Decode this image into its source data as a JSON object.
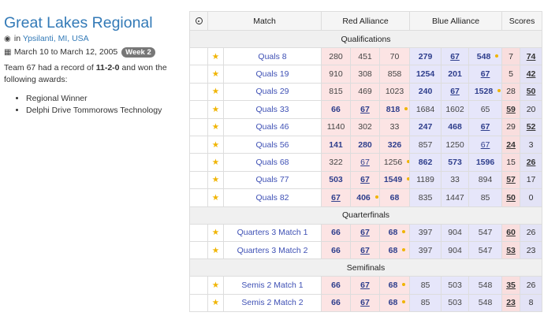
{
  "event": {
    "title": "Great Lakes Regional",
    "location_prefix": "in",
    "location": "Ypsilanti, MI, USA",
    "dates": "March 10 to March 12, 2005",
    "week_badge": "Week 2",
    "record_prefix": "Team 67 had a record of",
    "record": "11-2-0",
    "record_suffix": "and won the following awards:",
    "awards": [
      "Regional Winner",
      "Delphi Drive Tommorows Technology"
    ],
    "icons": {
      "location": "map-marker-icon",
      "dates": "calendar-icon"
    }
  },
  "table": {
    "headers": {
      "match": "Match",
      "red": "Red Alliance",
      "blue": "Blue Alliance",
      "scores": "Scores"
    },
    "colors": {
      "red_bg": "#fce4e4",
      "blue_bg": "#e6e6fa",
      "star": "#f0b400",
      "link": "#3f51b5"
    },
    "sections": [
      {
        "name": "Qualifications",
        "matches": [
          {
            "name": "Quals 8",
            "red": [
              "280",
              "451",
              "70"
            ],
            "blue": [
              "279",
              "67",
              "548"
            ],
            "red_score": "7",
            "blue_score": "74",
            "winner": "blue",
            "dot": [
              5
            ]
          },
          {
            "name": "Quals 19",
            "red": [
              "910",
              "308",
              "858"
            ],
            "blue": [
              "1254",
              "201",
              "67"
            ],
            "red_score": "5",
            "blue_score": "42",
            "winner": "blue",
            "dot": [
              6
            ]
          },
          {
            "name": "Quals 29",
            "red": [
              "815",
              "469",
              "1023"
            ],
            "blue": [
              "240",
              "67",
              "1528"
            ],
            "red_score": "28",
            "blue_score": "50",
            "winner": "blue",
            "dot": [
              5
            ]
          },
          {
            "name": "Quals 33",
            "red": [
              "66",
              "67",
              "818"
            ],
            "blue": [
              "1684",
              "1602",
              "65"
            ],
            "red_score": "59",
            "blue_score": "20",
            "winner": "red",
            "dot": [
              2
            ]
          },
          {
            "name": "Quals 46",
            "red": [
              "1140",
              "302",
              "33"
            ],
            "blue": [
              "247",
              "468",
              "67"
            ],
            "red_score": "29",
            "blue_score": "52",
            "winner": "blue",
            "dot": [
              6
            ]
          },
          {
            "name": "Quals 56",
            "red": [
              "141",
              "280",
              "326"
            ],
            "blue": [
              "857",
              "1250",
              "67"
            ],
            "red_score": "24",
            "blue_score": "3",
            "winner": "red",
            "dot": [
              6
            ]
          },
          {
            "name": "Quals 68",
            "red": [
              "322",
              "67",
              "1256"
            ],
            "blue": [
              "862",
              "573",
              "1596"
            ],
            "red_score": "15",
            "blue_score": "26",
            "winner": "blue",
            "dot": [
              2
            ]
          },
          {
            "name": "Quals 77",
            "red": [
              "503",
              "67",
              "1549"
            ],
            "blue": [
              "1189",
              "33",
              "894"
            ],
            "red_score": "57",
            "blue_score": "17",
            "winner": "red",
            "dot": [
              2
            ]
          },
          {
            "name": "Quals 82",
            "red": [
              "67",
              "406",
              "68"
            ],
            "blue": [
              "835",
              "1447",
              "85"
            ],
            "red_score": "50",
            "blue_score": "0",
            "winner": "red",
            "dot": [
              1
            ]
          }
        ]
      },
      {
        "name": "Quarterfinals",
        "matches": [
          {
            "name": "Quarters 3 Match 1",
            "red": [
              "66",
              "67",
              "68"
            ],
            "blue": [
              "397",
              "904",
              "547"
            ],
            "red_score": "60",
            "blue_score": "26",
            "winner": "red",
            "dot": [
              2
            ]
          },
          {
            "name": "Quarters 3 Match 2",
            "red": [
              "66",
              "67",
              "68"
            ],
            "blue": [
              "397",
              "904",
              "547"
            ],
            "red_score": "53",
            "blue_score": "23",
            "winner": "red",
            "dot": [
              2
            ]
          }
        ]
      },
      {
        "name": "Semifinals",
        "matches": [
          {
            "name": "Semis 2 Match 1",
            "red": [
              "66",
              "67",
              "68"
            ],
            "blue": [
              "85",
              "503",
              "548"
            ],
            "red_score": "35",
            "blue_score": "26",
            "winner": "red",
            "dot": [
              2
            ]
          },
          {
            "name": "Semis 2 Match 2",
            "red": [
              "66",
              "67",
              "68"
            ],
            "blue": [
              "85",
              "503",
              "548"
            ],
            "red_score": "23",
            "blue_score": "8",
            "winner": "red",
            "dot": [
              2
            ]
          }
        ]
      }
    ],
    "star_glyph": "★"
  }
}
